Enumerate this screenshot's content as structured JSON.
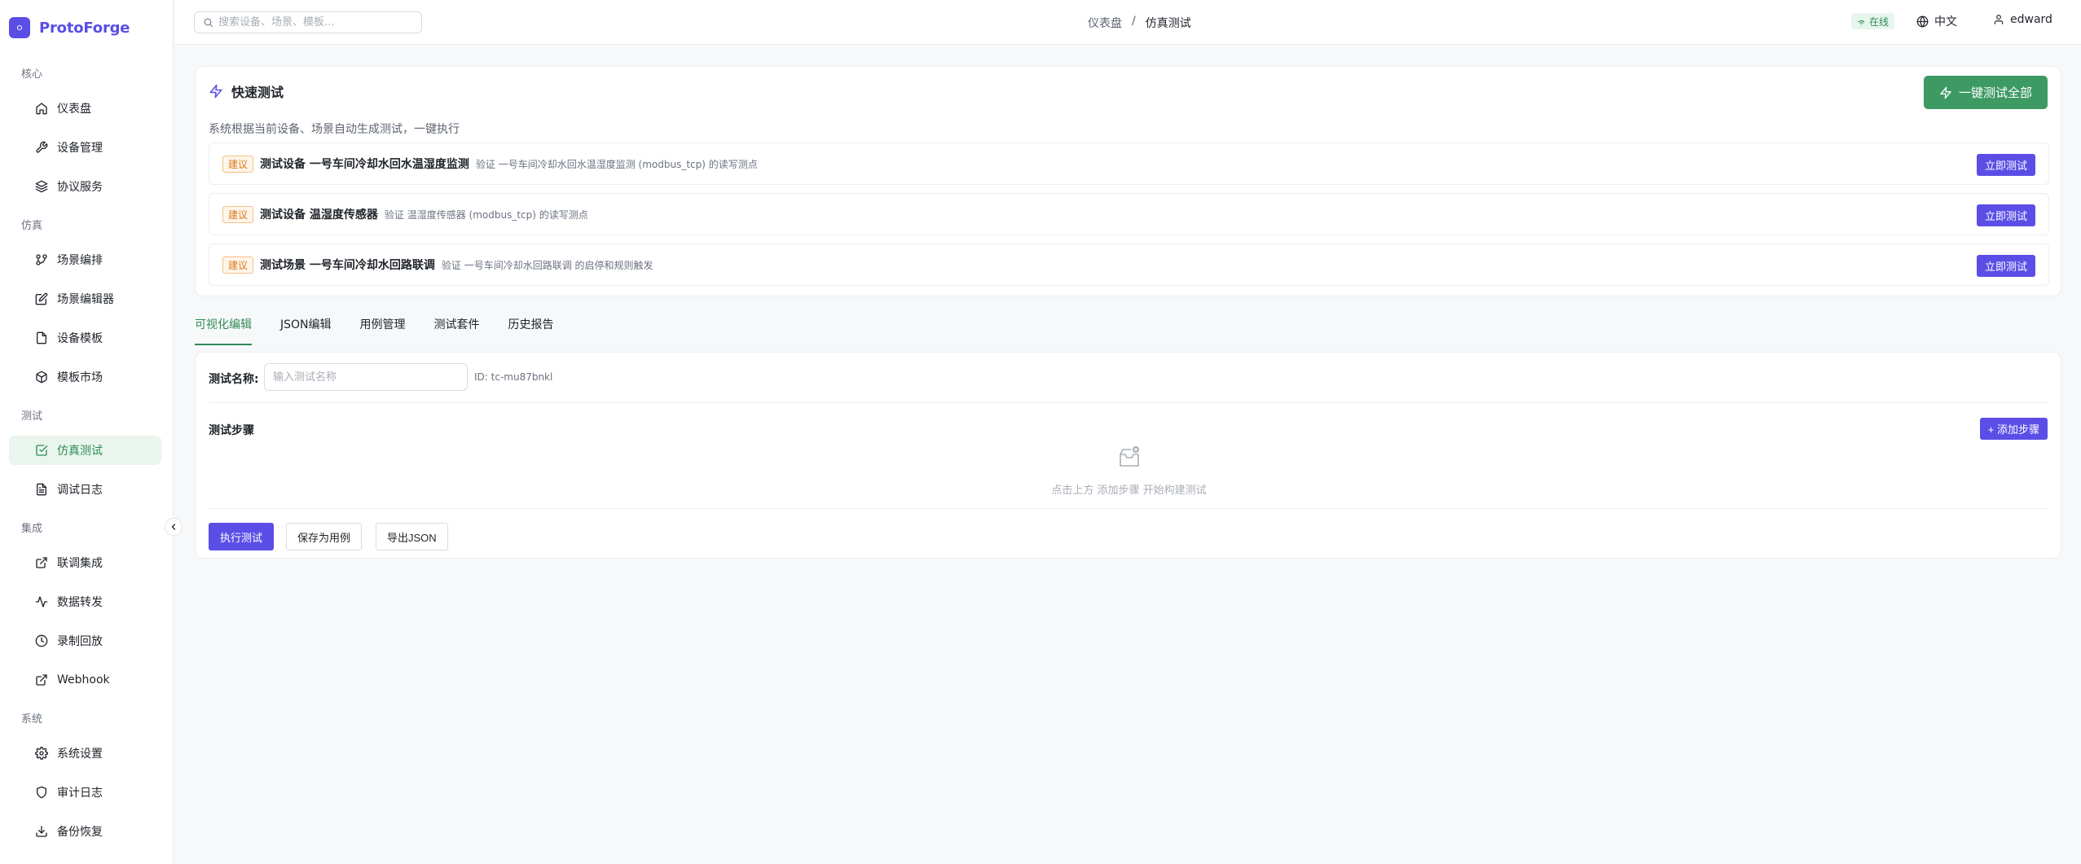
{
  "brand": {
    "name": "ProtoForge"
  },
  "sidebar": {
    "groups": [
      {
        "title": "核心",
        "items": [
          {
            "label": "仪表盘",
            "icon": "home-icon"
          },
          {
            "label": "设备管理",
            "icon": "wrench-icon"
          },
          {
            "label": "协议服务",
            "icon": "layers-icon"
          }
        ]
      },
      {
        "title": "仿真",
        "items": [
          {
            "label": "场景编排",
            "icon": "git-branch-icon"
          },
          {
            "label": "场景编辑器",
            "icon": "edit-icon"
          },
          {
            "label": "设备模板",
            "icon": "file-icon"
          },
          {
            "label": "模板市场",
            "icon": "package-icon"
          }
        ]
      },
      {
        "title": "测试",
        "items": [
          {
            "label": "仿真测试",
            "icon": "check-square-icon",
            "active": true
          },
          {
            "label": "调试日志",
            "icon": "file-text-icon"
          }
        ]
      },
      {
        "title": "集成",
        "items": [
          {
            "label": "联调集成",
            "icon": "external-link-icon"
          },
          {
            "label": "数据转发",
            "icon": "activity-icon"
          },
          {
            "label": "录制回放",
            "icon": "clock-icon"
          },
          {
            "label": "Webhook",
            "icon": "external-link-icon"
          }
        ]
      },
      {
        "title": "系统",
        "items": [
          {
            "label": "系统设置",
            "icon": "gear-icon"
          },
          {
            "label": "审计日志",
            "icon": "shield-icon"
          },
          {
            "label": "备份恢复",
            "icon": "download-icon"
          }
        ]
      }
    ]
  },
  "header": {
    "search_placeholder": "搜索设备、场景、模板...",
    "breadcrumb": [
      "仪表盘",
      "/",
      "仿真测试"
    ],
    "status": "在线",
    "language": "中文",
    "user": "edward"
  },
  "quick_test": {
    "title": "快速测试",
    "description": "系统根据当前设备、场景自动生成测试，一键执行",
    "run_all_label": "一键测试全部",
    "suggestions": [
      {
        "tag": "建议",
        "title": "测试设备 一号车间冷却水回水温湿度监测",
        "desc": "验证 一号车间冷却水回水温湿度监测 (modbus_tcp) 的读写测点",
        "button": "立即测试"
      },
      {
        "tag": "建议",
        "title": "测试设备 温湿度传感器",
        "desc": "验证 温湿度传感器 (modbus_tcp) 的读写测点",
        "button": "立即测试"
      },
      {
        "tag": "建议",
        "title": "测试场景 一号车间冷却水回路联调",
        "desc": "验证 一号车间冷却水回路联调 的启停和规则触发",
        "button": "立即测试"
      }
    ]
  },
  "tabs": [
    {
      "label": "可视化编辑",
      "active": true
    },
    {
      "label": "JSON编辑"
    },
    {
      "label": "用例管理"
    },
    {
      "label": "测试套件"
    },
    {
      "label": "历史报告"
    }
  ],
  "editor": {
    "name_label": "测试名称:",
    "name_placeholder": "输入测试名称",
    "id_text": "ID: tc-mu87bnkl",
    "steps_label": "测试步骤",
    "add_step_label": "+ 添加步骤",
    "empty_text": "点击上方 添加步骤 开始构建测试",
    "run_label": "执行测试",
    "save_label": "保存为用例",
    "export_label": "导出JSON"
  },
  "colors": {
    "brand": "#5b4ee6",
    "active_green": "#2e8b57",
    "run_all_green": "#3d9a62"
  }
}
